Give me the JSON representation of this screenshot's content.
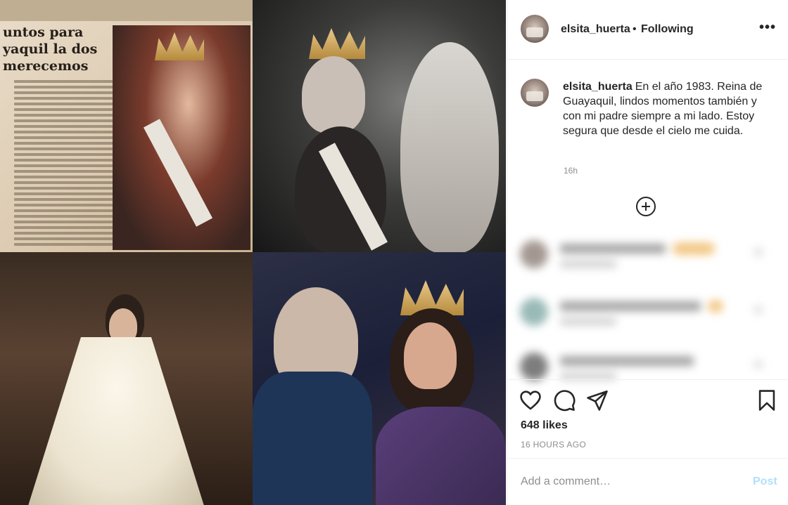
{
  "post": {
    "username": "elsita_huerta",
    "separator": "•",
    "follow_status": "Following",
    "more_glyph": "•••",
    "caption": "En el año 1983. Reina de Guayaquil, lindos momentos también y con mi padre siempre a mi lado. Estoy segura que desde el cielo me cuida.",
    "caption_time": "16h",
    "likes": "648 likes",
    "posted_ago": "16 HOURS AGO",
    "comment_placeholder": "Add a comment…",
    "post_label": "Post"
  },
  "photo": {
    "headline": "untos para yaquil la dos merecemos"
  },
  "icons": {
    "like": "heart-icon",
    "comment": "comment-bubble-icon",
    "share": "paper-plane-icon",
    "save": "bookmark-icon",
    "load_more": "plus-circle-icon",
    "options": "ellipsis-icon"
  },
  "colors": {
    "text": "#262626",
    "muted": "#8e8e8e",
    "border": "#efefef",
    "post_disabled": "#b2dffc"
  }
}
